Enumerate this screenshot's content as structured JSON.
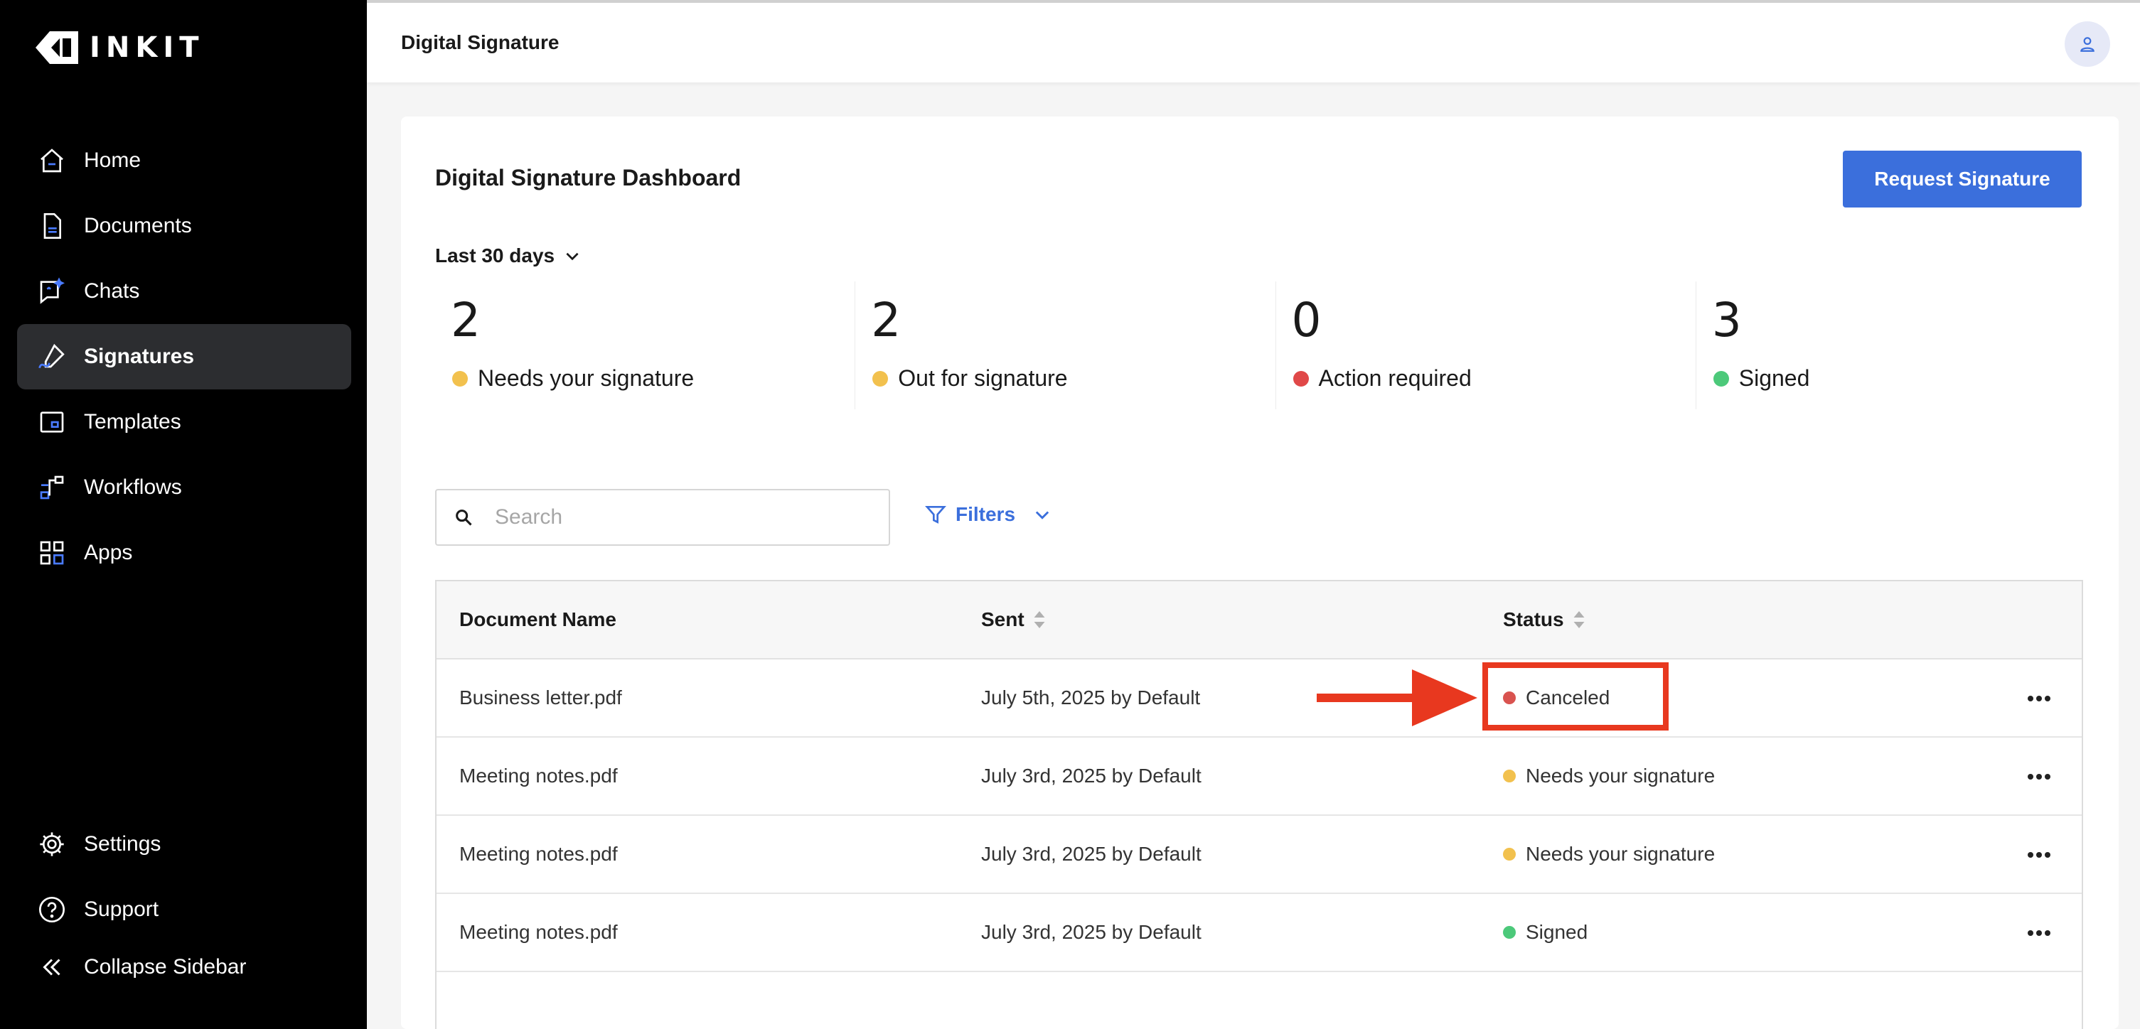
{
  "brand": {
    "name": "INKIT"
  },
  "sidebar": {
    "items": [
      {
        "label": "Home",
        "icon": "home-icon"
      },
      {
        "label": "Documents",
        "icon": "document-icon"
      },
      {
        "label": "Chats",
        "icon": "chat-icon"
      },
      {
        "label": "Signatures",
        "icon": "signature-pen-icon",
        "active": true
      },
      {
        "label": "Templates",
        "icon": "template-icon"
      },
      {
        "label": "Workflows",
        "icon": "workflow-icon"
      },
      {
        "label": "Apps",
        "icon": "apps-grid-icon"
      }
    ],
    "bottom": [
      {
        "label": "Settings",
        "icon": "gear-icon"
      },
      {
        "label": "Support",
        "icon": "help-circle-icon"
      },
      {
        "label": "Collapse Sidebar",
        "icon": "chevron-double-left-icon"
      }
    ]
  },
  "header": {
    "title": "Digital Signature"
  },
  "dashboard": {
    "title": "Digital Signature Dashboard",
    "request_button": "Request Signature",
    "range": "Last 30 days",
    "stats": [
      {
        "value": "2",
        "label": "Needs your signature",
        "color": "#f2c14e"
      },
      {
        "value": "2",
        "label": "Out for signature",
        "color": "#f2c14e"
      },
      {
        "value": "0",
        "label": "Action required",
        "color": "#e04848"
      },
      {
        "value": "3",
        "label": "Signed",
        "color": "#4cc97a"
      }
    ]
  },
  "search": {
    "placeholder": "Search"
  },
  "filters": {
    "label": "Filters"
  },
  "table": {
    "headers": {
      "name": "Document Name",
      "sent": "Sent",
      "status": "Status"
    },
    "rows": [
      {
        "name": "Business letter.pdf",
        "sent": "July 5th, 2025 by Default",
        "status": "Canceled",
        "status_color": "#d9534f"
      },
      {
        "name": "Meeting notes.pdf",
        "sent": "July 3rd, 2025 by Default",
        "status": "Needs your signature",
        "status_color": "#f2c14e"
      },
      {
        "name": "Meeting notes.pdf",
        "sent": "July 3rd, 2025 by Default",
        "status": "Needs your signature",
        "status_color": "#f2c14e"
      },
      {
        "name": "Meeting notes.pdf",
        "sent": "July 3rd, 2025 by Default",
        "status": "Signed",
        "status_color": "#4cc97a"
      }
    ]
  },
  "colors": {
    "accent": "#3b6fdc",
    "annotation": "#e8381f",
    "sidebar": "#000000"
  }
}
